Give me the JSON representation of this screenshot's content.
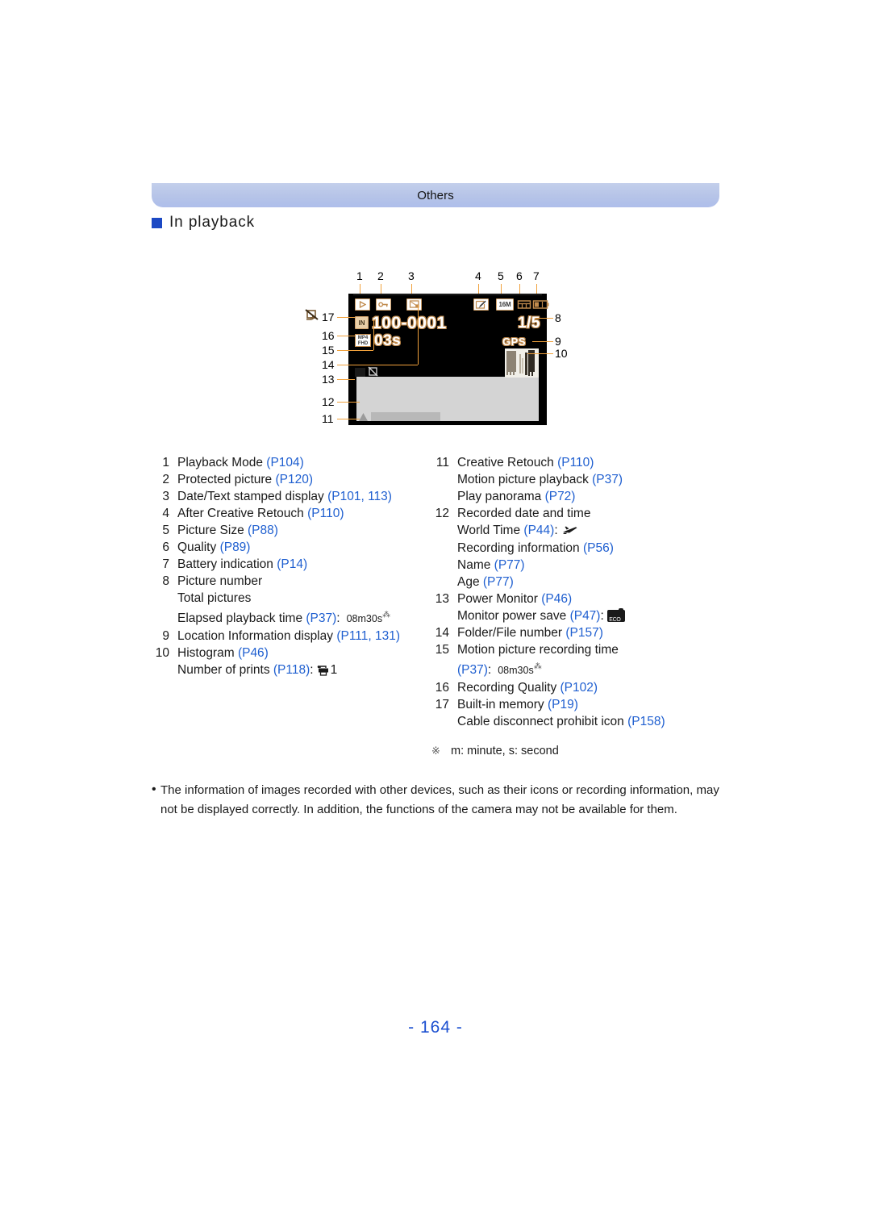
{
  "banner": {
    "title": "Others"
  },
  "section": {
    "heading": "In playback"
  },
  "diagram": {
    "top_numbers": [
      "1",
      "2",
      "3",
      "4",
      "5",
      "6",
      "7"
    ],
    "right_numbers": [
      "8",
      "9",
      "10"
    ],
    "left_numbers": [
      "17",
      "16",
      "15",
      "14",
      "13",
      "12",
      "11"
    ],
    "screen": {
      "playback_mode_icon": "play-triangle",
      "protected_icon": "key-lock",
      "date_stamp_icon": "date-stamp",
      "after_retouch_icon": "retouch-pen",
      "picture_size_label": "16M",
      "quality_icon": "quality-grid",
      "battery_icon": "battery",
      "builtin_memory_icon": "IN",
      "folder_file_number": "100-0001",
      "picture_number": "1/5",
      "recording_quality_label": "MP4 / FHD",
      "motion_picture_time": "03s",
      "gps_label": "GPS",
      "histogram_icon": "histogram",
      "power_monitor_icon": "power-monitor",
      "cable_prohibit_icon": "cable-disconnect-prohibit",
      "panorama_arrow_icon": "play-panorama-arrow"
    }
  },
  "list": {
    "left": [
      {
        "num": "1",
        "text": "Playback Mode ",
        "ref": "(P104)"
      },
      {
        "num": "2",
        "text": "Protected picture ",
        "ref": "(P120)"
      },
      {
        "num": "3",
        "text": "Date/Text stamped display ",
        "ref": "(P101, 113)"
      },
      {
        "num": "4",
        "text": "After Creative Retouch ",
        "ref": "(P110)"
      },
      {
        "num": "5",
        "text": "Picture Size ",
        "ref": "(P88)"
      },
      {
        "num": "6",
        "text": "Quality ",
        "ref": "(P89)"
      },
      {
        "num": "7",
        "text": "Battery indication ",
        "ref": "(P14)"
      },
      {
        "num": "8",
        "text": "Picture number",
        "ref": ""
      },
      {
        "num": "",
        "text": "Total pictures",
        "ref": ""
      },
      {
        "num": "",
        "text": "Elapsed playback time ",
        "ref": "(P37)",
        "suffix": ":",
        "value": "08m30s",
        "star": true
      },
      {
        "num": "9",
        "text": "Location Information display ",
        "ref": "(P111, 131)"
      },
      {
        "num": "10",
        "text": "Histogram ",
        "ref": "(P46)"
      },
      {
        "num": "",
        "text": "Number of prints ",
        "ref": "(P118)",
        "suffix": ":",
        "value": "1",
        "icon": "print-icon"
      }
    ],
    "right": [
      {
        "num": "11",
        "text": "Creative Retouch ",
        "ref": "(P110)"
      },
      {
        "num": "",
        "text": "Motion picture playback ",
        "ref": "(P37)"
      },
      {
        "num": "",
        "text": "Play panorama ",
        "ref": "(P72)"
      },
      {
        "num": "12",
        "text": "Recorded date and time",
        "ref": ""
      },
      {
        "num": "",
        "text": "World Time ",
        "ref": "(P44)",
        "suffix": ":",
        "icon": "airplane-icon"
      },
      {
        "num": "",
        "text": "Recording information ",
        "ref": "(P56)"
      },
      {
        "num": "",
        "text": "Name ",
        "ref": "(P77)"
      },
      {
        "num": "",
        "text": "Age ",
        "ref": "(P77)"
      },
      {
        "num": "13",
        "text": "Power Monitor ",
        "ref": "(P46)"
      },
      {
        "num": "",
        "text": "Monitor power save ",
        "ref": "(P47)",
        "suffix": ":",
        "icon": "eco-icon"
      },
      {
        "num": "14",
        "text": "Folder/File number ",
        "ref": "(P157)"
      },
      {
        "num": "15",
        "text": "Motion picture recording time",
        "ref": ""
      },
      {
        "num": "",
        "text": "",
        "ref": "(P37)",
        "suffix": ":",
        "value": "08m30s",
        "star": true
      },
      {
        "num": "16",
        "text": "Recording Quality ",
        "ref": "(P102)"
      },
      {
        "num": "17",
        "text": "Built-in memory ",
        "ref": "(P19)"
      },
      {
        "num": "",
        "text": "Cable disconnect prohibit icon ",
        "ref": "(P158)"
      }
    ],
    "footnote": {
      "marker": "※",
      "text": "m: minute, s: second"
    }
  },
  "note": {
    "bullet": "•",
    "text": "The information of images recorded with other devices, such as their icons or recording information, may not be displayed correctly. In addition, the functions of the camera may not be available for them."
  },
  "footer": {
    "page": "- 164 -"
  },
  "colors": {
    "banner": "#b6c4e8",
    "link": "#1f5fd0",
    "bullet": "#1c49c4",
    "callout": "#f0a13c",
    "page_number": "#1b4fd0"
  }
}
